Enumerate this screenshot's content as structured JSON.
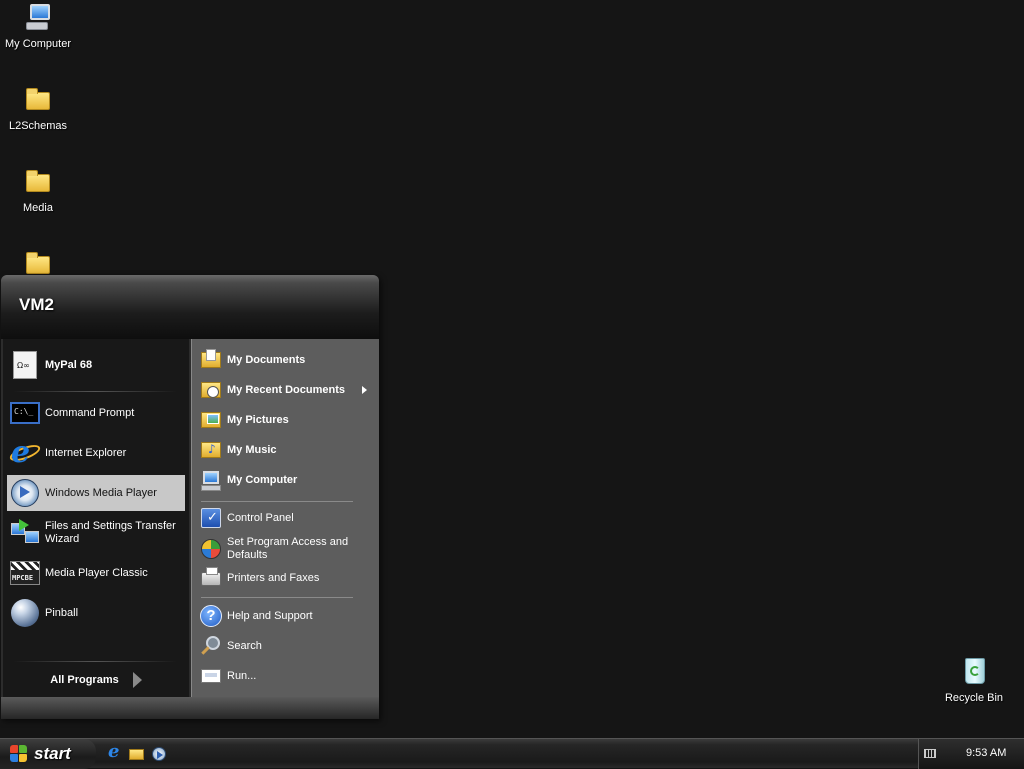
{
  "desktop": {
    "icons": [
      {
        "label": "My Computer"
      },
      {
        "label": "L2Schemas"
      },
      {
        "label": "Media"
      },
      {
        "label": ""
      },
      {
        "label": "Recycle Bin"
      }
    ]
  },
  "start_menu": {
    "username": "VM2",
    "pinned": [
      {
        "label": "MyPal 68",
        "icon": "mypal-icon"
      }
    ],
    "recent": [
      {
        "label": "Command Prompt",
        "icon": "command-prompt-icon"
      },
      {
        "label": "Internet Explorer",
        "icon": "internet-explorer-icon"
      },
      {
        "label": "Windows Media Player",
        "icon": "windows-media-player-icon",
        "highlighted": true
      },
      {
        "label": "Files and Settings Transfer Wizard",
        "icon": "transfer-wizard-icon"
      },
      {
        "label": "Media Player Classic",
        "icon": "media-player-classic-icon"
      },
      {
        "label": "Pinball",
        "icon": "pinball-icon"
      }
    ],
    "all_programs": "All Programs",
    "places": [
      {
        "label": "My Documents",
        "icon": "documents-folder-icon"
      },
      {
        "label": "My Recent Documents",
        "icon": "recent-documents-icon",
        "submenu": true
      },
      {
        "label": "My Pictures",
        "icon": "pictures-folder-icon"
      },
      {
        "label": "My Music",
        "icon": "music-folder-icon"
      },
      {
        "label": "My Computer",
        "icon": "computer-icon"
      }
    ],
    "settings": [
      {
        "label": "Control Panel",
        "icon": "control-panel-icon"
      },
      {
        "label": "Set Program Access and Defaults",
        "icon": "program-access-icon"
      },
      {
        "label": "Printers and Faxes",
        "icon": "printer-icon"
      }
    ],
    "tools": [
      {
        "label": "Help and Support",
        "icon": "help-icon"
      },
      {
        "label": "Search",
        "icon": "search-icon"
      },
      {
        "label": "Run...",
        "icon": "run-icon"
      }
    ]
  },
  "taskbar": {
    "start_label": "start",
    "clock": "9:53 AM"
  },
  "colors": {
    "desktop_bg": "#151515",
    "menu_left_bg": "#181818",
    "menu_right_bg": "#5d5d5d",
    "highlight_bg": "#c8c8c8"
  }
}
